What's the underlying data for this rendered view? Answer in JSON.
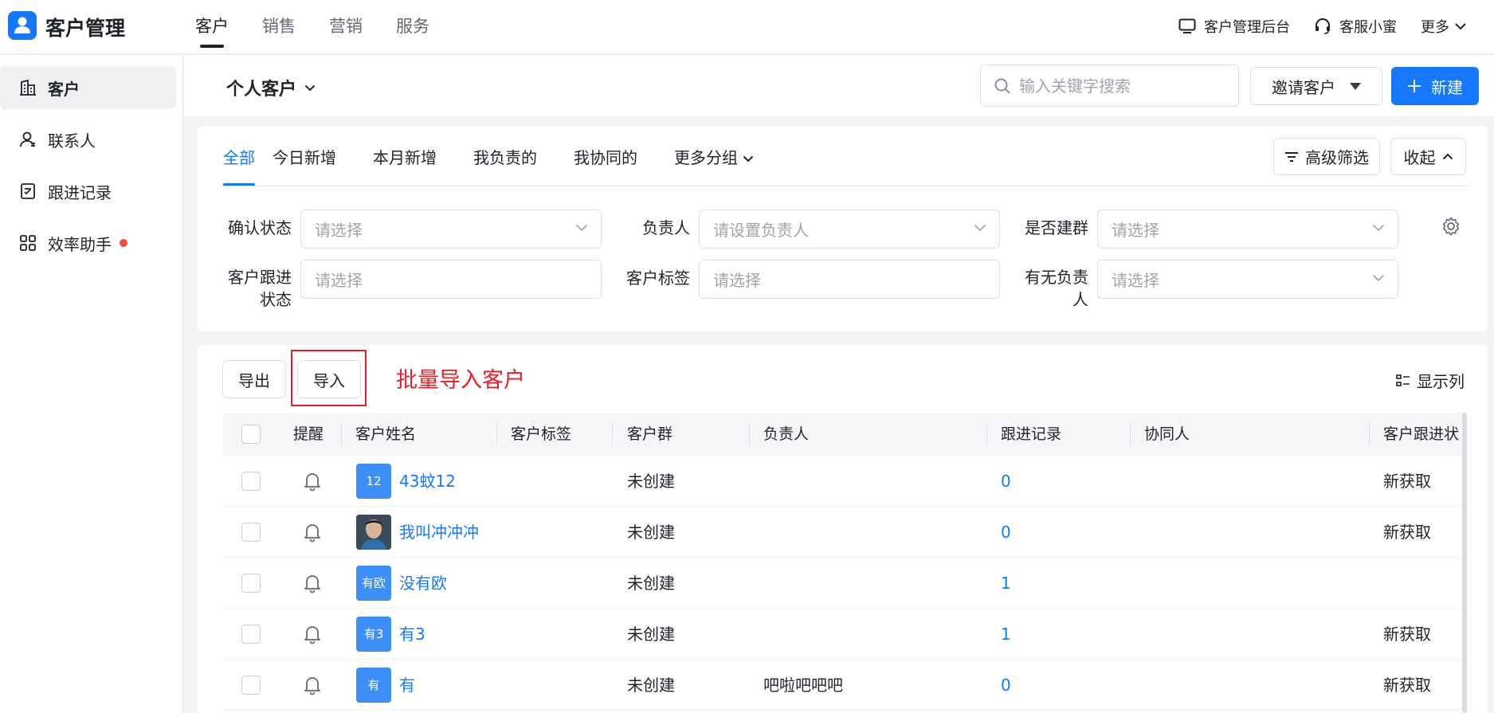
{
  "app": {
    "title": "客户管理"
  },
  "nav": [
    "客户",
    "销售",
    "营销",
    "服务"
  ],
  "top_right": {
    "admin": "客户管理后台",
    "service": "客服小蜜",
    "more": "更多"
  },
  "sidebar": {
    "items": [
      {
        "label": "客户",
        "icon": "building-icon"
      },
      {
        "label": "联系人",
        "icon": "contact-icon"
      },
      {
        "label": "跟进记录",
        "icon": "record-icon"
      },
      {
        "label": "效率助手",
        "icon": "apps-icon"
      }
    ]
  },
  "header": {
    "title": "个人客户",
    "search_placeholder": "输入关键字搜索",
    "invite_label": "邀请客户",
    "new_label": "新建"
  },
  "tabs": [
    "全部",
    "今日新增",
    "本月新增",
    "我负责的",
    "我协同的",
    "更多分组"
  ],
  "filter_actions": {
    "advanced": "高级筛选",
    "collapse": "收起"
  },
  "filters": {
    "confirm_status": {
      "label": "确认状态",
      "placeholder": "请选择"
    },
    "owner": {
      "label": "负责人",
      "placeholder": "请设置负责人"
    },
    "group_built": {
      "label": "是否建群",
      "placeholder": "请选择"
    },
    "follow_status": {
      "label_line1": "客户跟进",
      "label_line2": "状态",
      "placeholder": "请选择"
    },
    "tag": {
      "label": "客户标签",
      "placeholder": "请选择"
    },
    "has_owner": {
      "label_line1": "有无负责",
      "label_line2": "人",
      "placeholder": "请选择"
    }
  },
  "toolbar": {
    "export": "导出",
    "import": "导入",
    "annotation": "批量导入客户",
    "show_columns": "显示列"
  },
  "table": {
    "columns": {
      "remind": "提醒",
      "name": "客户姓名",
      "tag": "客户标签",
      "group": "客户群",
      "owner": "负责人",
      "follow": "跟进记录",
      "collab": "协同人",
      "follow_status": "客户跟进状"
    },
    "rows": [
      {
        "avatar": "12",
        "name": "43蚊12",
        "group": "未创建",
        "owner": "",
        "follow": "0",
        "status": "新获取"
      },
      {
        "avatar": "",
        "name": "我叫冲冲冲",
        "group": "未创建",
        "owner": "",
        "follow": "0",
        "status": "新获取"
      },
      {
        "avatar": "有欧",
        "name": "没有欧",
        "group": "未创建",
        "owner": "",
        "follow": "1",
        "status": ""
      },
      {
        "avatar": "有3",
        "name": "有3",
        "group": "未创建",
        "owner": "",
        "follow": "1",
        "status": "新获取"
      },
      {
        "avatar": "有",
        "name": "有",
        "group": "未创建",
        "owner": "吧啦吧吧吧",
        "follow": "0",
        "status": "新获取"
      }
    ]
  },
  "colors": {
    "primary": "#1677ff",
    "annotation": "#e5202a",
    "dot": "#f54a45"
  }
}
